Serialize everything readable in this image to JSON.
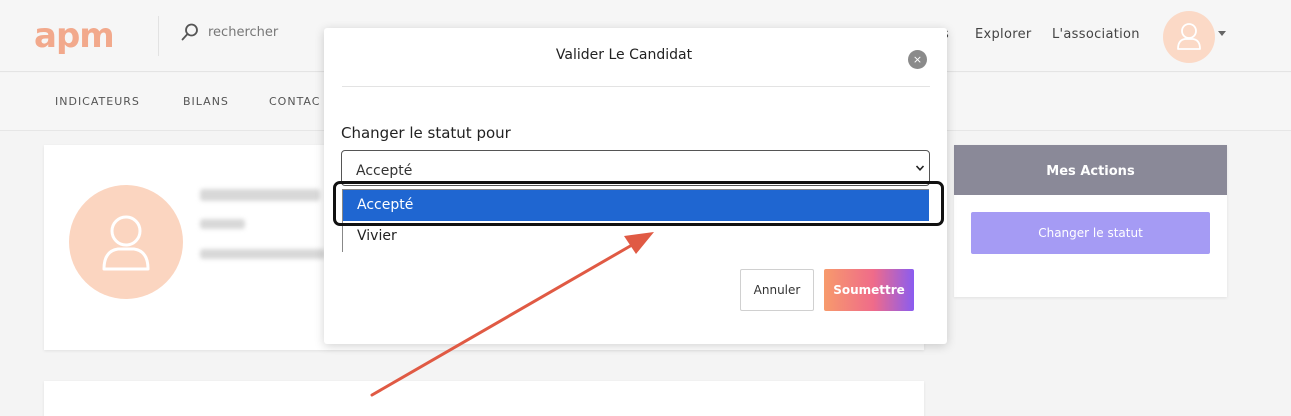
{
  "header": {
    "logo_text": "apm",
    "search_placeholder": "rechercher",
    "nav": [
      {
        "label": "s"
      },
      {
        "label": "Explorer"
      },
      {
        "label": "L'association"
      }
    ]
  },
  "subnav": {
    "items": [
      {
        "label": "INDICATEURS"
      },
      {
        "label": "BILANS"
      },
      {
        "label": "CONTAC"
      }
    ]
  },
  "actions_panel": {
    "title": "Mes Actions",
    "button_label": "Changer le statut"
  },
  "modal": {
    "title": "Valider Le Candidat",
    "close_glyph": "×",
    "field_label": "Changer le statut pour",
    "selected_value": "Accepté",
    "options": [
      "Accepté",
      "Vivier"
    ],
    "cancel_label": "Annuler",
    "submit_label": "Soumettre"
  },
  "colors": {
    "brand": "#f2a98c",
    "selected_option": "#1f66d1",
    "actions_header": "#8a8998",
    "actions_button": "#a59bf4",
    "annotation_arrow": "#e05a44"
  }
}
